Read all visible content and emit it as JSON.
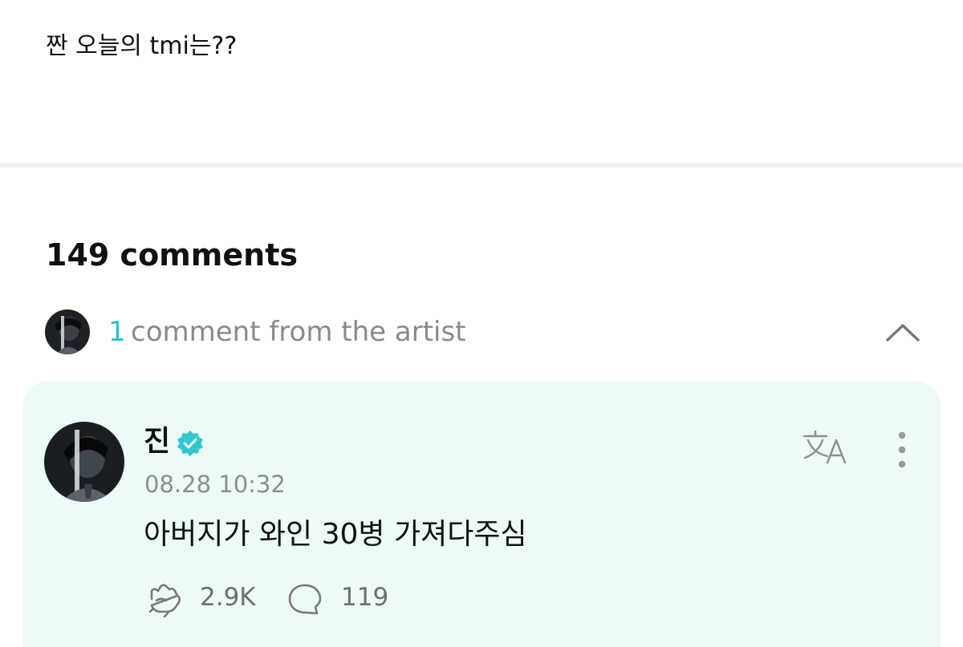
{
  "post": {
    "text": "짠 오늘의 tmi는??"
  },
  "comments": {
    "count_label": "149 comments"
  },
  "artist_comments": {
    "count": "1",
    "label": "comment from the artist",
    "collapse_icon": "chevron-up-icon"
  },
  "artist_comment": {
    "author": "진",
    "verified_icon": "verified-badge-icon",
    "date": "08.28 10:32",
    "body": "아버지가 와인 30병 가져다주심",
    "translate_icon": "translate-icon",
    "more_icon": "more-vertical-icon",
    "likes": "2.9K",
    "replies": "119",
    "like_icon": "cheer-hand-icon",
    "reply_icon": "comment-bubble-icon"
  },
  "colors": {
    "accent": "#25c4c9",
    "card_background": "#ecfaf8",
    "muted_text": "#8a8a8a"
  }
}
